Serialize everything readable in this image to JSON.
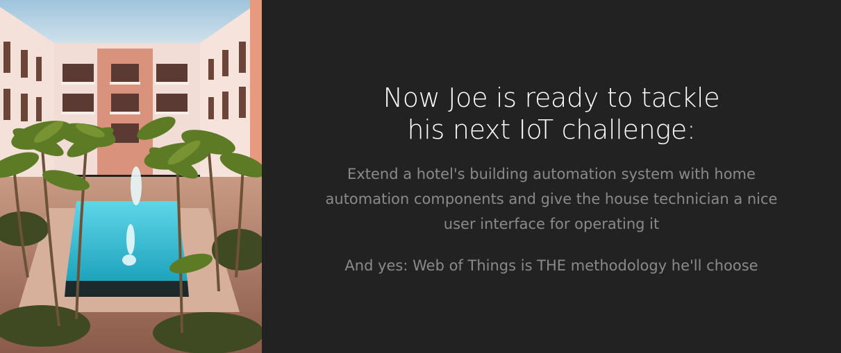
{
  "slide": {
    "image": {
      "subject": "hotel courtyard with pool, fountain and palm trees"
    },
    "title_lines": [
      "Now Joe is ready to tackle",
      "his next IoT challenge:"
    ],
    "body_lines": [
      "Extend a hotel's building automation system with home",
      "automation components and give the house technician a nice",
      "user interface for operating it"
    ],
    "tagline": "And yes: Web of Things is THE methodology he'll choose"
  },
  "colors": {
    "background": "#222222",
    "title": "#ffffff",
    "body": "#8a8a8a"
  }
}
